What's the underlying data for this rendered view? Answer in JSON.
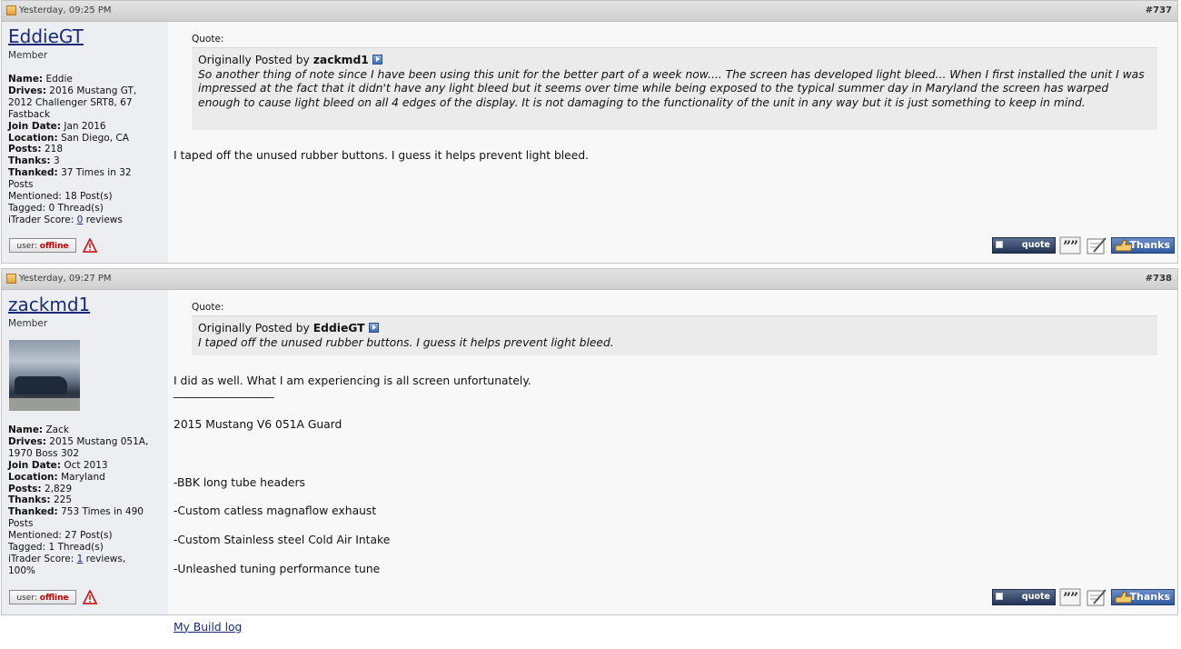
{
  "posts": [
    {
      "date": "Yesterday, 09:25 PM",
      "number": "#737",
      "username": "EddieGT",
      "usertitle": "Member",
      "info": {
        "name_label": "Name:",
        "name": "Eddie",
        "drives_label": "Drives:",
        "drives_1": "2016 Mustang GT,",
        "drives_2": "2012 Challenger SRT8, 67",
        "drives_3": "Fastback",
        "join_label": "Join Date:",
        "join": "Jan 2016",
        "location_label": "Location:",
        "location": "San Diego, CA",
        "posts_label": "Posts:",
        "posts": "218",
        "thanks_label": "Thanks:",
        "thanks": "3",
        "thanked_label": "Thanked:",
        "thanked_1": "37 Times in 32",
        "thanked_2": "Posts",
        "mentioned": "Mentioned: 18 Post(s)",
        "tagged": "Tagged: 0 Thread(s)",
        "itrader_label": "iTrader Score:",
        "itrader_num": "0",
        "itrader_rest": "reviews"
      },
      "status_prefix": "user:",
      "status": "offline",
      "quote_label": "Quote:",
      "quote_prefix": "Originally Posted by",
      "quote_author": "zackmd1",
      "quote_text": "So another thing of note since I have been using this unit for the better part of a week now.... The screen has developed light bleed... When I first installed the unit I was impressed at the fact that it didn't have any light bleed but it seems over time while being exposed to the typical summer day in Maryland the screen has warped enough to cause light bleed on all 4 edges of the display. It is not damaging to the functionality of the unit in any way but it is just something to keep in mind.",
      "body": "I taped off the unused rubber buttons. I guess it helps prevent light bleed.",
      "buttons": {
        "quote": "quote",
        "thanks": "Thanks"
      }
    },
    {
      "date": "Yesterday, 09:27 PM",
      "number": "#738",
      "username": "zackmd1",
      "usertitle": "Member",
      "info": {
        "name_label": "Name:",
        "name": "Zack",
        "drives_label": "Drives:",
        "drives_1": "2015 Mustang 051A,",
        "drives_2": "1970 Boss 302",
        "join_label": "Join Date:",
        "join": "Oct 2013",
        "location_label": "Location:",
        "location": "Maryland",
        "posts_label": "Posts:",
        "posts": "2,829",
        "thanks_label": "Thanks:",
        "thanks": "225",
        "thanked_label": "Thanked:",
        "thanked_1": "753 Times in 490",
        "thanked_2": "Posts",
        "mentioned": "Mentioned: 27 Post(s)",
        "tagged": "Tagged: 1 Thread(s)",
        "itrader_label": "iTrader Score:",
        "itrader_num": "1",
        "itrader_rest": "reviews,",
        "itrader_pct": "100%"
      },
      "status_prefix": "user:",
      "status": "offline",
      "quote_label": "Quote:",
      "quote_prefix": "Originally Posted by",
      "quote_author": "EddieGT",
      "quote_text": "I taped off the unused rubber buttons. I guess it helps prevent light bleed.",
      "body": "I did as well. What I am experiencing is all screen unfortunately.",
      "signature_rule": "__________________",
      "signature_lines": [
        "2015 Mustang V6 051A Guard",
        "",
        "-BBK long tube headers",
        "-Custom catless magnaflow exhaust",
        "-Custom Stainless steel Cold Air Intake",
        "-Unleashed tuning performance tune",
        ""
      ],
      "build_link": "My Build log",
      "buttons": {
        "quote": "quote",
        "thanks": "Thanks"
      }
    }
  ]
}
